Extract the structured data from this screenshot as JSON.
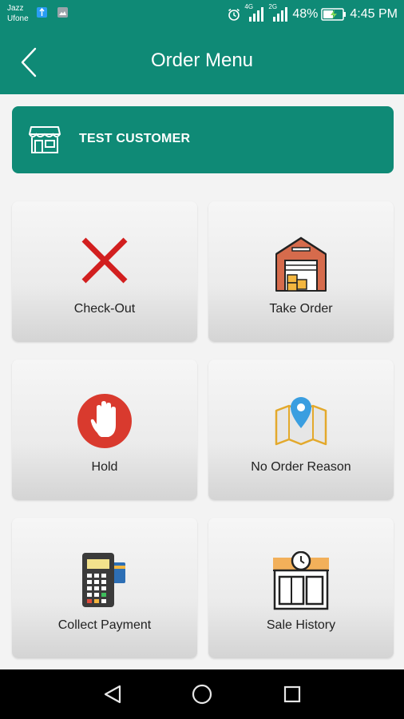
{
  "status_bar": {
    "carrier_primary": "Jazz",
    "carrier_secondary": "Ufone",
    "network1": "4G",
    "network2": "2G",
    "battery": "48%",
    "time": "4:45 PM"
  },
  "app_bar": {
    "title": "Order Menu"
  },
  "customer": {
    "name": "TEST CUSTOMER"
  },
  "menu": {
    "items": [
      {
        "label": "Check-Out",
        "icon": "close-x-icon"
      },
      {
        "label": "Take Order",
        "icon": "warehouse-icon"
      },
      {
        "label": "Hold",
        "icon": "stop-hand-icon"
      },
      {
        "label": "No Order Reason",
        "icon": "map-pin-icon"
      },
      {
        "label": "Collect Payment",
        "icon": "pos-terminal-icon"
      },
      {
        "label": "Sale History",
        "icon": "shop-clock-icon"
      }
    ]
  },
  "colors": {
    "primary": "#0f8a76",
    "tile": "#ebebeb",
    "check_out_red": "#d21f1f",
    "hold_red": "#d93a2e",
    "map_pin_blue": "#3a9ee0"
  }
}
